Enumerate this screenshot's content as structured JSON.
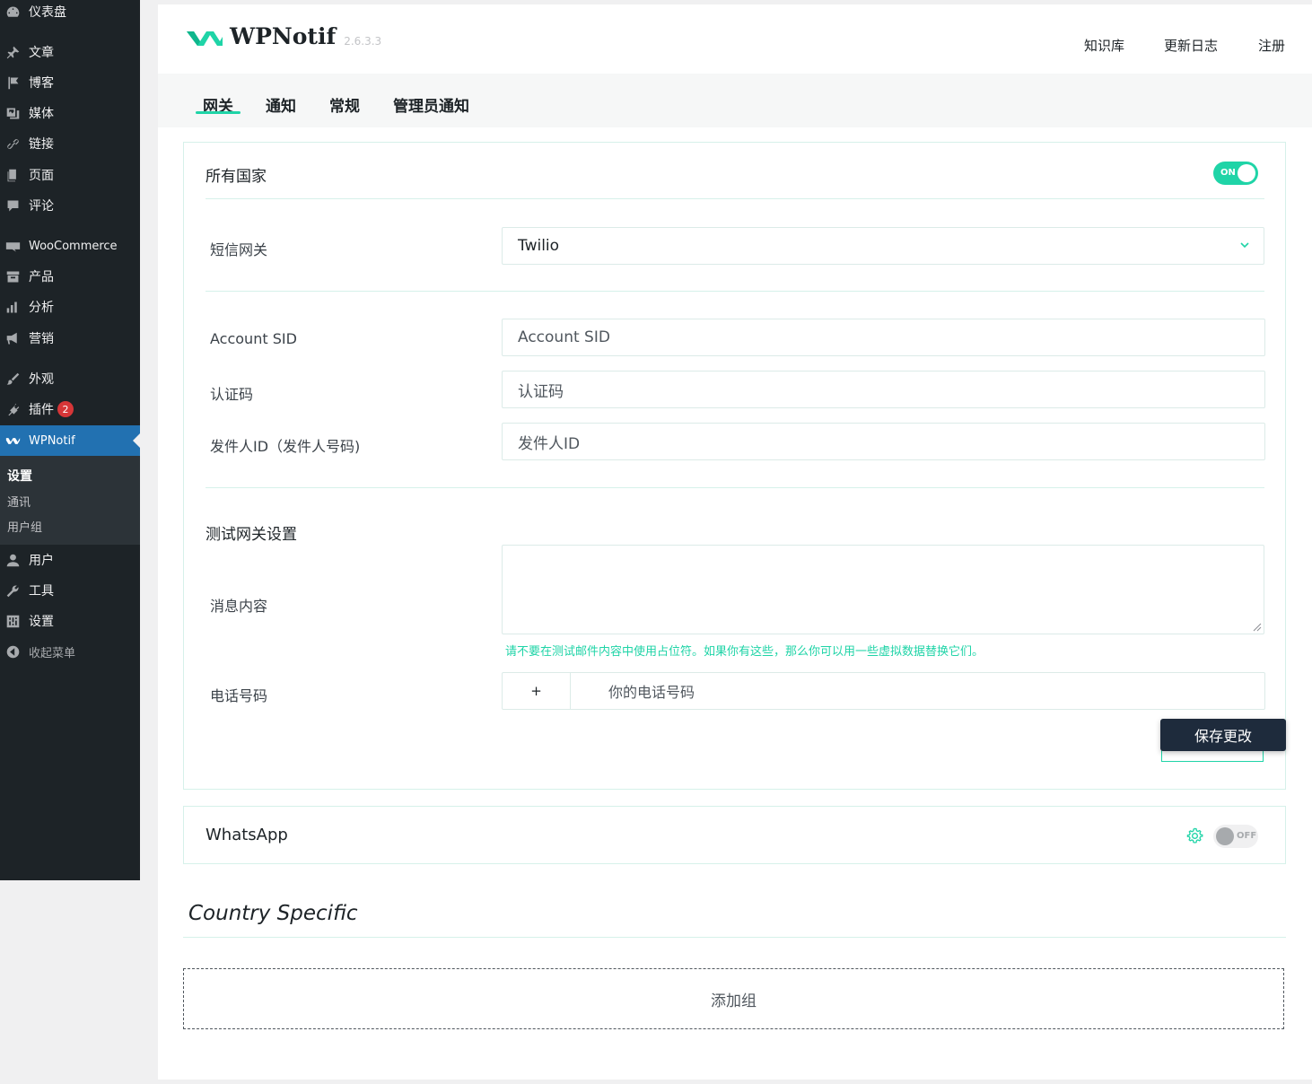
{
  "sidebar": {
    "items": [
      {
        "label": "仪表盘",
        "icon": "dashboard-icon"
      },
      {
        "label": "文章",
        "icon": "pushpin-icon"
      },
      {
        "label": "博客",
        "icon": "flag-icon"
      },
      {
        "label": "媒体",
        "icon": "media-icon"
      },
      {
        "label": "链接",
        "icon": "link-icon"
      },
      {
        "label": "页面",
        "icon": "page-icon"
      },
      {
        "label": "评论",
        "icon": "comment-icon"
      },
      {
        "label": "WooCommerce",
        "icon": "woo-icon"
      },
      {
        "label": "产品",
        "icon": "archive-icon"
      },
      {
        "label": "分析",
        "icon": "bar-chart-icon"
      },
      {
        "label": "营销",
        "icon": "megaphone-icon"
      },
      {
        "label": "外观",
        "icon": "brush-icon"
      },
      {
        "label": "插件",
        "icon": "plugin-icon",
        "badge": "2"
      },
      {
        "label": "WPNotif",
        "icon": "wpnotif-icon"
      },
      {
        "label": "用户",
        "icon": "user-icon"
      },
      {
        "label": "工具",
        "icon": "wrench-icon"
      },
      {
        "label": "设置",
        "icon": "settings-icon"
      },
      {
        "label": "收起菜单",
        "icon": "collapse-icon"
      }
    ],
    "submenu": [
      "设置",
      "通讯",
      "用户组"
    ]
  },
  "header": {
    "brand": "WPNotif",
    "version": "2.6.3.3",
    "links": [
      "知识库",
      "更新日志",
      "注册"
    ]
  },
  "tabs": [
    "网关",
    "通知",
    "常规",
    "管理员通知"
  ],
  "all_countries": {
    "title": "所有国家",
    "toggle": "ON",
    "gateway_label": "短信网关",
    "gateway_value": "Twilio",
    "sid_label": "Account SID",
    "sid_placeholder": "Account SID",
    "auth_label": "认证码",
    "auth_placeholder": "认证码",
    "sender_label": "发件人ID（发件人号码)",
    "sender_placeholder": "发件人ID",
    "test_title": "测试网关设置",
    "message_label": "消息内容",
    "hint": "请不要在测试邮件内容中使用占位符。如果你有这些，那么你可以用一些虚拟数据替换它们。",
    "phone_label": "电话号码",
    "phone_prefix": "+",
    "phone_placeholder": "你的电话号码",
    "save": "保存更改"
  },
  "whatsapp": {
    "title": "WhatsApp",
    "toggle": "OFF"
  },
  "country_specific": {
    "title": "Country Specific",
    "add_group": "添加组"
  },
  "colors": {
    "accent": "#1fd4a7",
    "sidebar": "#1d2327",
    "active": "#2271b1",
    "button": "#1e2b3c"
  }
}
